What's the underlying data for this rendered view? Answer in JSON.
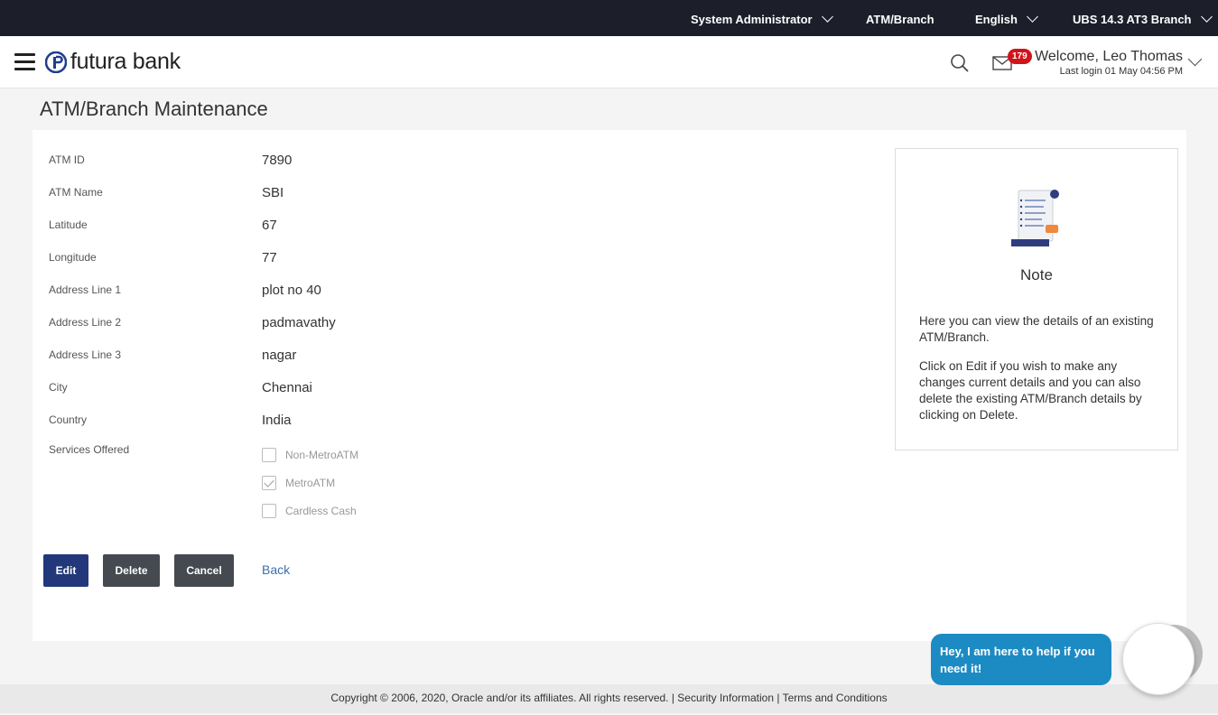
{
  "topbar": {
    "role": "System Administrator",
    "module": "ATM/Branch",
    "language": "English",
    "branch": "UBS 14.3 AT3 Branch"
  },
  "header": {
    "brand": "futura bank",
    "notifications": "179",
    "welcome": "Welcome, Leo Thomas",
    "last_login": "Last login 01 May 04:56 PM"
  },
  "page": {
    "title": "ATM/Branch Maintenance"
  },
  "details": [
    {
      "label": "ATM ID",
      "value": "7890"
    },
    {
      "label": "ATM Name",
      "value": "SBI"
    },
    {
      "label": "Latitude",
      "value": "67"
    },
    {
      "label": "Longitude",
      "value": "77"
    },
    {
      "label": "Address Line 1",
      "value": "plot no 40"
    },
    {
      "label": "Address Line 2",
      "value": "padmavathy"
    },
    {
      "label": "Address Line 3",
      "value": "nagar"
    },
    {
      "label": "City",
      "value": "Chennai"
    },
    {
      "label": "Country",
      "value": "India"
    }
  ],
  "services": {
    "label": "Services Offered",
    "options": [
      {
        "label": "Non-MetroATM",
        "checked": false
      },
      {
        "label": "MetroATM",
        "checked": true
      },
      {
        "label": "Cardless Cash",
        "checked": false
      }
    ]
  },
  "actions": {
    "edit": "Edit",
    "delete": "Delete",
    "cancel": "Cancel",
    "back": "Back"
  },
  "note": {
    "title": "Note",
    "p1": "Here you can view the details of an existing ATM/Branch.",
    "p2": "Click on Edit if you wish to make any changes current details and you can also delete the existing ATM/Branch details by clicking on Delete."
  },
  "footer": {
    "text": "Copyright © 2006, 2020, Oracle and/or its affiliates. All rights reserved. | Security Information | Terms and Conditions"
  },
  "chat": {
    "message": "Hey, I am here to help if you need it!"
  },
  "colors": {
    "primary_button": "#23387a",
    "secondary_button": "#454a50",
    "topbar": "#1c1e2a",
    "badge": "#d0141b",
    "chat": "#1d8bc3"
  }
}
